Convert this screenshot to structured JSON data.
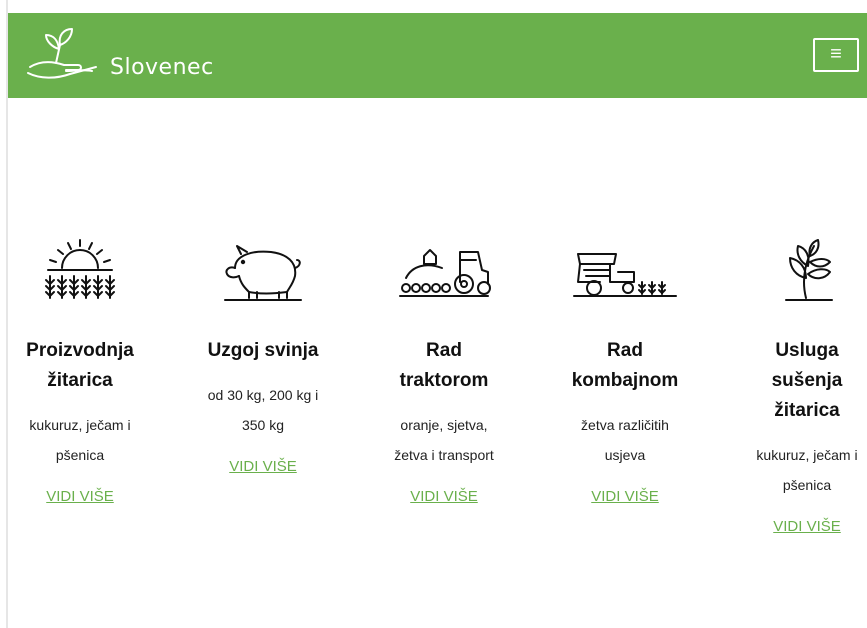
{
  "brand": {
    "name": "Slovenec",
    "accent": "#6ab04c"
  },
  "header": {
    "menu_icon": "hamburger-icon",
    "menu_glyph": "≡"
  },
  "services": [
    {
      "icon": "sunrise-wheat-icon",
      "title_line1": "Proizvodnja",
      "title_line2": "žitarica",
      "desc_line1": "kukuruz, ječam i",
      "desc_line2": "pšenica",
      "link": "VIDI VIŠE"
    },
    {
      "icon": "pig-icon",
      "title_line1": "Uzgoj svinja",
      "title_line2": "",
      "desc_line1": "od 30 kg, 200 kg i",
      "desc_line2": "350 kg",
      "link": "VIDI VIŠE"
    },
    {
      "icon": "tractor-icon",
      "title_line1": "Rad",
      "title_line2": "traktorom",
      "desc_line1": "oranje, sjetva,",
      "desc_line2": "žetva i transport",
      "link": "VIDI VIŠE"
    },
    {
      "icon": "combine-harvester-icon",
      "title_line1": "Rad",
      "title_line2": "kombajnom",
      "desc_line1": "žetva različitih",
      "desc_line2": "usjeva",
      "link": "VIDI VIŠE"
    },
    {
      "icon": "wheat-icon",
      "title_line1": "Usluga",
      "title_line2": "sušenja",
      "title_line3": "žitarica",
      "desc_line1": "kukuruz, ječam i",
      "desc_line2": "pšenica",
      "link": "VIDI VIŠE"
    }
  ]
}
